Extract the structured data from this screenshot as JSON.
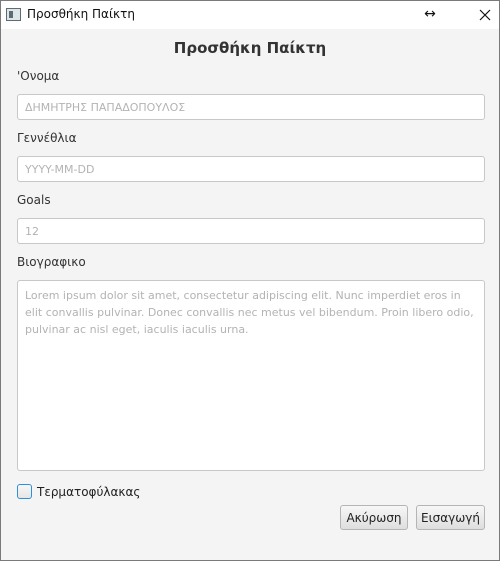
{
  "window": {
    "title": "Προσθήκη Παίκτη",
    "icons": {
      "app": "app-window-icon",
      "resize": "horizontal-resize-icon",
      "close": "close-icon"
    }
  },
  "form": {
    "title": "Προσθήκη Παίκτη",
    "name": {
      "label": "'Ονομα",
      "value": "",
      "placeholder": "ΔΗΜΗΤΡΗΣ ΠΑΠΑΔΟΠΟΥΛΟΣ"
    },
    "birthdate": {
      "label": "Γεννέθλια",
      "value": "",
      "placeholder": "YYYY-MM-DD"
    },
    "goals": {
      "label": "Goals",
      "value": "",
      "placeholder": "12"
    },
    "bio": {
      "label": "Βιογραφικο",
      "value": "",
      "placeholder": "Lorem ipsum dolor sit amet, consectetur adipiscing elit. Nunc imperdiet eros in elit convallis pulvinar. Donec convallis nec metus vel bibendum. Proin libero odio, pulvinar ac nisl eget, iaculis iaculis urna."
    },
    "goalkeeper": {
      "label": "Τερματοφύλακας",
      "checked": false
    },
    "buttons": {
      "cancel": "Ακύρωση",
      "insert": "Εισαγωγή"
    }
  },
  "colors": {
    "focus_accent": "#2f8fd8",
    "window_bg": "#f4f4f4"
  }
}
